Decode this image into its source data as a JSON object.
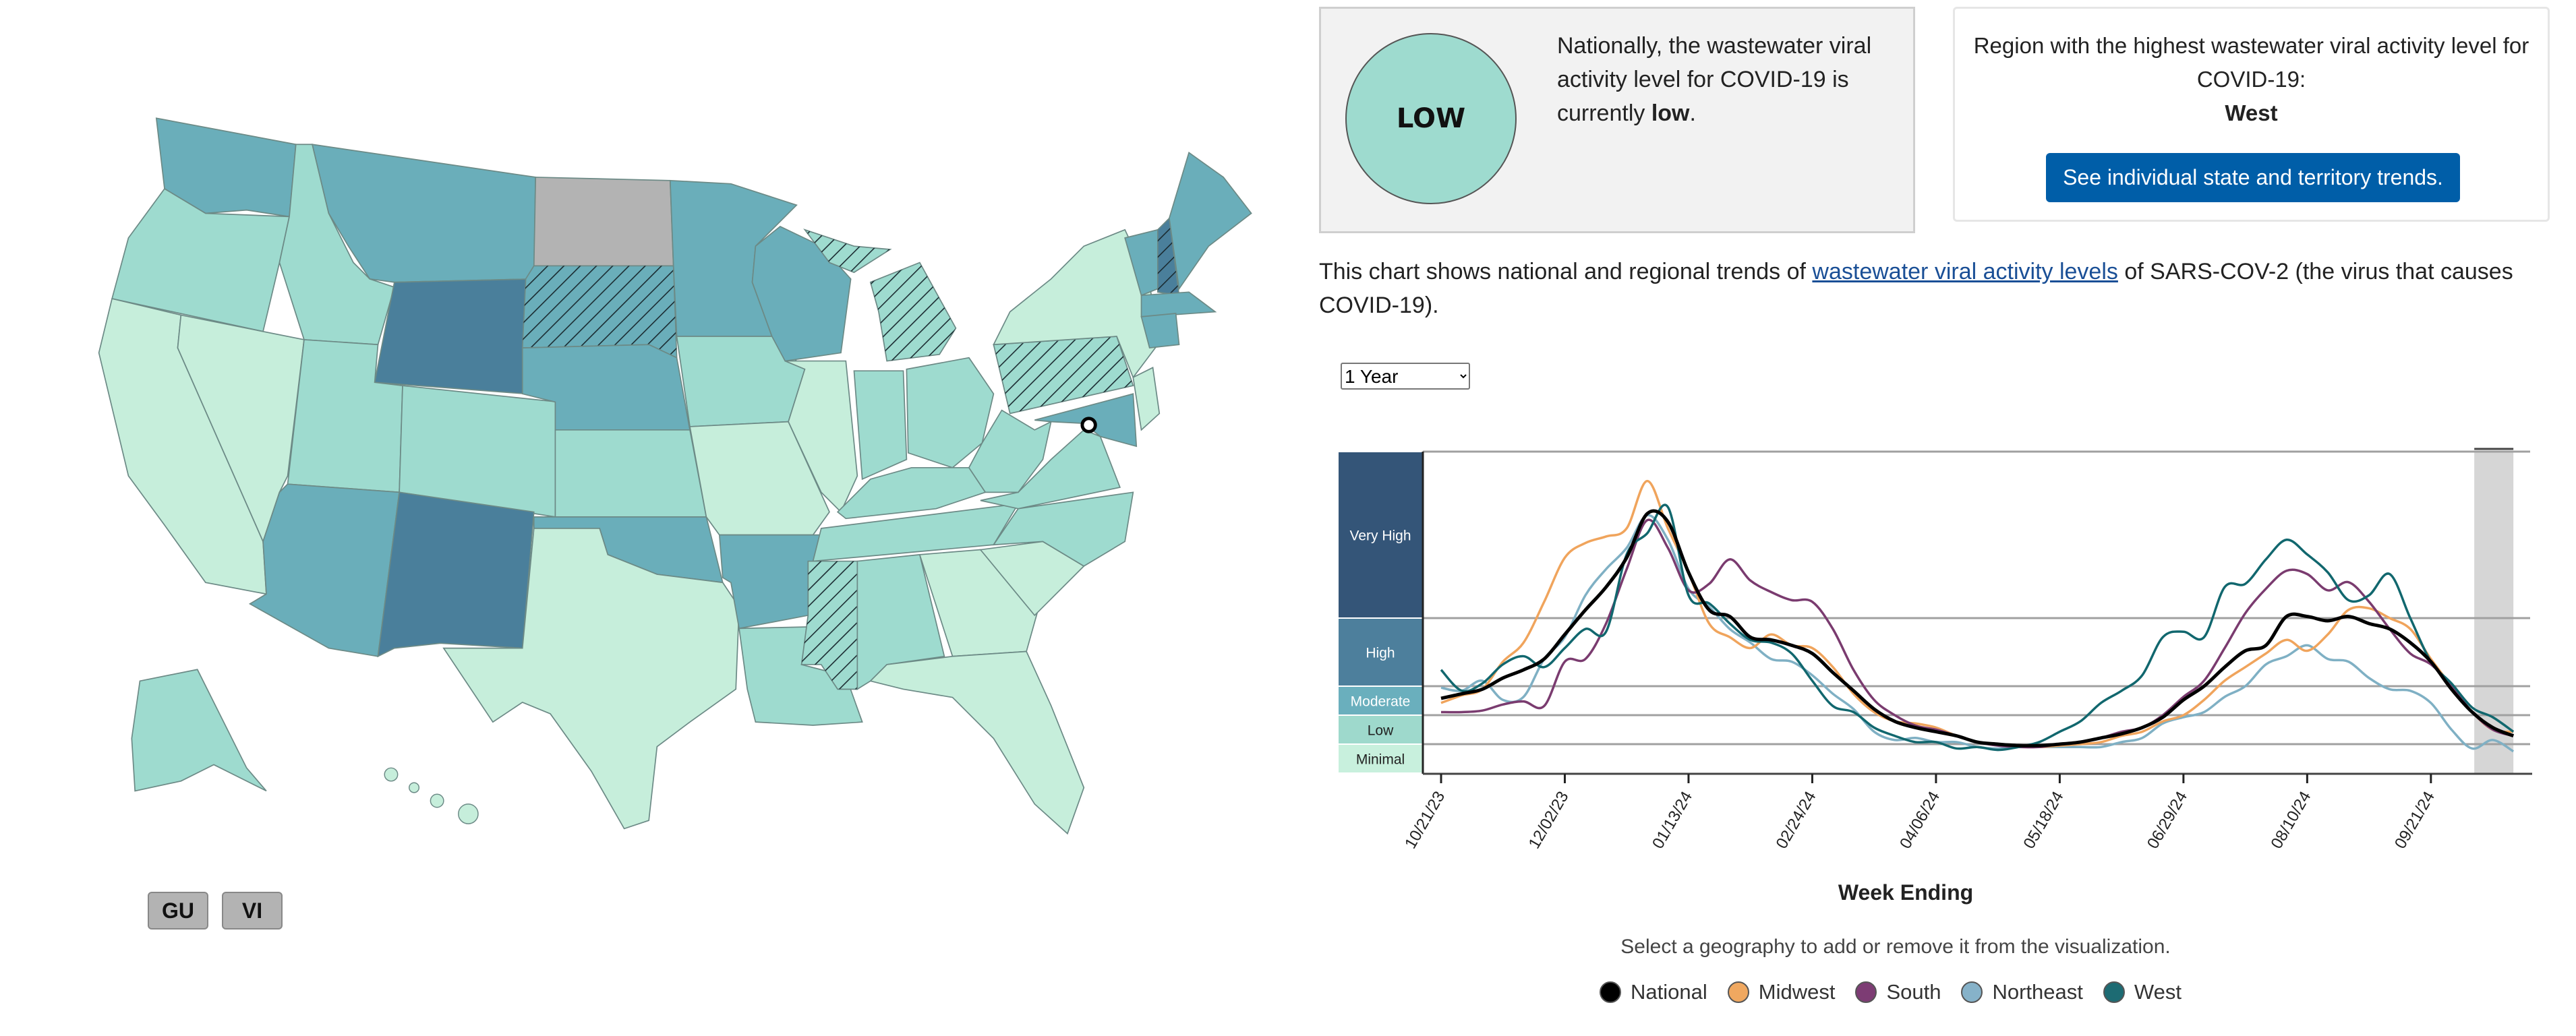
{
  "map": {
    "colors": {
      "minimal": "#c6eedb",
      "low": "#9edbcf",
      "moderate": "#6aaeba",
      "high": "#4a7f9b",
      "very_high": "#345578",
      "no_data": "#b3b3b3"
    },
    "states": {
      "WA": "moderate",
      "OR": "low",
      "CA": "minimal",
      "NV": "minimal",
      "ID": "low",
      "MT": "moderate",
      "WY": "high",
      "UT": "low",
      "CO": "low",
      "AZ": "moderate",
      "NM": "high",
      "ND": "no_data",
      "SD": "moderate",
      "NE": "moderate",
      "KS": "low",
      "OK": "moderate",
      "TX": "minimal",
      "MN": "moderate",
      "IA": "low",
      "MO": "minimal",
      "AR": "moderate",
      "LA": "low",
      "WI": "moderate",
      "IL": "minimal",
      "MI": "low",
      "IN": "low",
      "OH": "low",
      "KY": "low",
      "TN": "low",
      "MS": "low",
      "AL": "low",
      "GA": "minimal",
      "FL": "minimal",
      "SC": "minimal",
      "NC": "low",
      "VA": "low",
      "WV": "low",
      "PA": "low",
      "NY": "minimal",
      "MD": "moderate",
      "NJ": "minimal",
      "VT": "moderate",
      "NH": "high",
      "ME": "moderate",
      "MA": "moderate",
      "CT": "moderate",
      "AK": "low",
      "HI": "minimal"
    },
    "hatched": [
      "SD",
      "MI",
      "PA",
      "MS",
      "NH"
    ],
    "territories": [
      "GU",
      "VI"
    ]
  },
  "national": {
    "level_badge": "LOW",
    "text_before": "Nationally, the wastewater viral activity level for COVID-19 is currently ",
    "text_level": "low",
    "text_after": "."
  },
  "region": {
    "text": "Region with the highest wastewater viral activity level for COVID-19:",
    "name": "West",
    "button_label": "See individual state and territory trends."
  },
  "description": {
    "before": "This chart shows national and regional trends of ",
    "link": "wastewater viral activity levels",
    "after": " of SARS-COV-2 (the virus that causes COVID-19)."
  },
  "range_select": {
    "selected": "1 Year"
  },
  "hint": "Select a geography to add or remove it from the visualization.",
  "chart_data": {
    "type": "line",
    "xlabel": "Week Ending",
    "ylabel": "",
    "x_start": "10/21/23",
    "x_interval": "weekly",
    "x_ticks": [
      "10/21/23",
      "12/02/23",
      "01/13/24",
      "02/24/24",
      "04/06/24",
      "05/18/24",
      "06/29/24",
      "08/10/24",
      "09/21/24"
    ],
    "levels": [
      {
        "name": "Very High",
        "color": "#345578"
      },
      {
        "name": "High",
        "color": "#4d7f9c"
      },
      {
        "name": "Moderate",
        "color": "#6aafbd"
      },
      {
        "name": "Low",
        "color": "#9ed9cc"
      },
      {
        "name": "Minimal",
        "color": "#c8f0dd"
      }
    ],
    "level_thresholds": [
      2,
      3.4,
      5.3,
      7.8
    ],
    "ylim": [
      0,
      18
    ],
    "grid": true,
    "provisional_weeks_shaded": 2,
    "series": [
      {
        "name": "National",
        "color": "#000000",
        "values": [
          4.5,
          4.8,
          5.1,
          5.6,
          5.9,
          6.3,
          7.2,
          8.3,
          9.7,
          11.5,
          14.2,
          13.7,
          10.6,
          8.3,
          7.9,
          7.1,
          7.0,
          6.8,
          6.5,
          5.8,
          5.0,
          3.8,
          3.1,
          2.8,
          2.6,
          2.4,
          2.1,
          2.0,
          1.9,
          1.9,
          2.0,
          2.1,
          2.3,
          2.5,
          2.8,
          3.3,
          4.4,
          5.3,
          6.0,
          6.6,
          6.8,
          7.9,
          7.9,
          7.7,
          7.9,
          7.6,
          7.4,
          6.9,
          6.2,
          5.1,
          3.6,
          2.8,
          2.4
        ]
      },
      {
        "name": "Midwest",
        "color": "#f0a45c",
        "values": [
          4.2,
          4.7,
          5.1,
          6.2,
          6.9,
          8.8,
          11.5,
          12.4,
          12.8,
          13.3,
          16.2,
          13.3,
          10.6,
          7.6,
          7.1,
          6.7,
          7.2,
          6.8,
          6.7,
          6.0,
          4.8,
          3.6,
          3.1,
          3.0,
          2.8,
          2.4,
          2.1,
          2.0,
          1.9,
          1.8,
          1.9,
          2.0,
          2.1,
          2.4,
          2.6,
          3.1,
          3.4,
          4.4,
          5.5,
          6.0,
          6.5,
          7.0,
          6.6,
          7.2,
          8.3,
          8.4,
          7.8,
          7.4,
          6.3,
          5.3,
          3.6,
          2.7,
          2.6
        ]
      },
      {
        "name": "South",
        "color": "#7a3b6f",
        "values": [
          3.6,
          3.6,
          3.7,
          4.1,
          4.3,
          4.0,
          6.2,
          6.3,
          7.6,
          10.8,
          13.8,
          12.1,
          9.5,
          9.9,
          11.4,
          10.1,
          9.4,
          8.9,
          8.8,
          7.4,
          5.9,
          4.4,
          3.4,
          2.9,
          2.7,
          2.4,
          2.1,
          1.9,
          1.8,
          1.8,
          2.0,
          2.1,
          2.3,
          2.6,
          2.8,
          3.4,
          4.6,
          5.5,
          6.7,
          8.1,
          9.6,
          10.7,
          10.5,
          9.5,
          10.0,
          8.8,
          7.4,
          6.5,
          6.1,
          5.3,
          3.6,
          2.7,
          2.4
        ]
      },
      {
        "name": "Northeast",
        "color": "#7fb0c4",
        "values": [
          5.2,
          5.0,
          5.5,
          4.4,
          4.6,
          6.3,
          7.1,
          9.2,
          10.8,
          12.1,
          14.1,
          12.6,
          9.6,
          8.5,
          7.4,
          6.9,
          6.3,
          6.2,
          5.7,
          4.8,
          3.8,
          2.6,
          2.2,
          2.3,
          2.1,
          2.1,
          1.8,
          1.7,
          1.8,
          1.8,
          1.8,
          1.8,
          1.8,
          2.1,
          2.3,
          3.0,
          3.3,
          3.6,
          4.6,
          5.3,
          6.1,
          6.4,
          6.8,
          6.3,
          6.2,
          5.6,
          5.1,
          5.0,
          4.2,
          2.7,
          1.7,
          2.2,
          1.5
        ]
      },
      {
        "name": "West",
        "color": "#11676e",
        "values": [
          5.9,
          5.0,
          5.4,
          6.1,
          6.4,
          6.0,
          6.7,
          7.4,
          7.3,
          11.7,
          13.0,
          14.6,
          9.2,
          8.7,
          7.6,
          7.0,
          6.9,
          6.5,
          5.5,
          4.0,
          3.6,
          2.8,
          2.4,
          2.1,
          2.1,
          1.7,
          1.8,
          1.6,
          1.8,
          2.1,
          2.6,
          3.1,
          4.2,
          5.0,
          5.7,
          7.1,
          7.3,
          7.1,
          9.7,
          9.9,
          11.4,
          12.6,
          11.7,
          10.6,
          8.9,
          9.2,
          10.5,
          7.8,
          6.2,
          5.4,
          3.9,
          3.3,
          2.6
        ]
      }
    ]
  },
  "legend": [
    {
      "name": "National",
      "color": "#000000"
    },
    {
      "name": "Midwest",
      "color": "#f0a860"
    },
    {
      "name": "South",
      "color": "#7d3c74"
    },
    {
      "name": "Northeast",
      "color": "#86b2c9"
    },
    {
      "name": "West",
      "color": "#1d6b73"
    }
  ]
}
